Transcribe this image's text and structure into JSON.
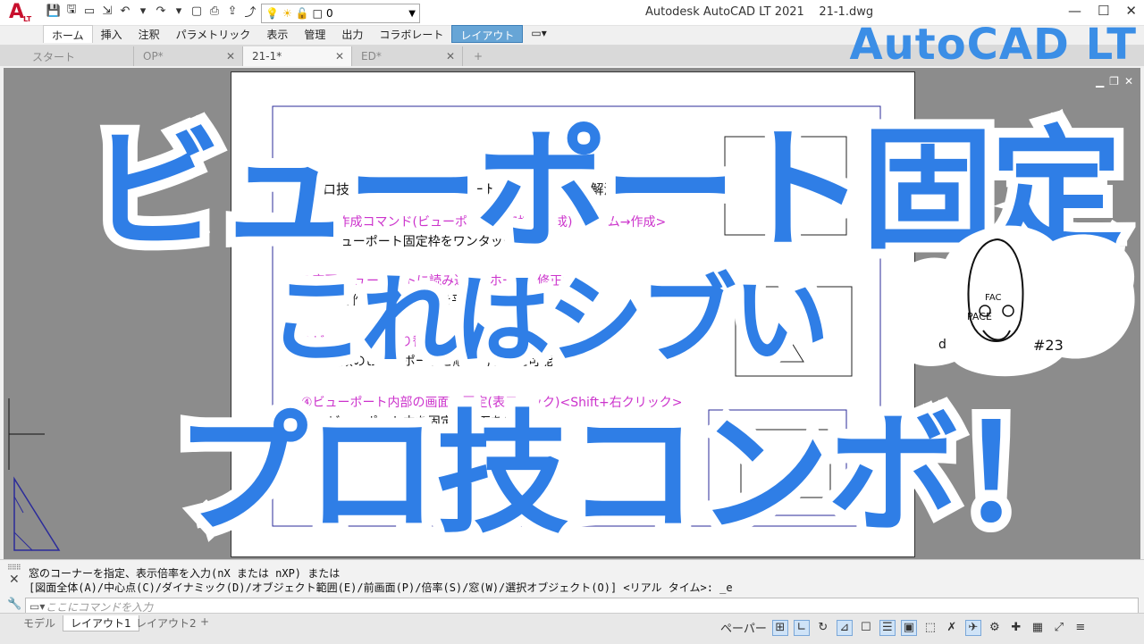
{
  "app": {
    "title": "Autodesk AutoCAD LT 2021",
    "file": "21-1.dwg",
    "logo_letter": "A",
    "logo_sub": "LT"
  },
  "layer_value": "0",
  "ribbon_tabs": [
    "ホーム",
    "挿入",
    "注釈",
    "パラメトリック",
    "表示",
    "管理",
    "出力",
    "コラボレート",
    "レイアウト"
  ],
  "doc_tabs": [
    "スタート",
    "OP*",
    "21-1*",
    "ED*"
  ],
  "brand": "AutoCAD LT",
  "paper_text": {
    "heading": "【プロ技コンボ！】ビューポートの固定はこれで解消！",
    "line1": "①境界作成コマンド(ビューポート固定枠の作成)<ホーム→作成>",
    "line2": "→ビューポート固定枠をワンタッチ作成",
    "line3": "②変更 ビューポートに読み込み<ホーム→修正>",
    "line4": "→①で作成した固定枠を平行移動(画面はdrafts)に",
    "line5": "③ビューポート切り替え<CTRL+R>",
    "line6": "→複数のビューポートを順次切り替え可能",
    "line7": "④ビューポート内部の画面の固定(表示ロック)<Shift+右クリック>",
    "line8": "→ビューポート内を固定、画面をズーム"
  },
  "overlay": {
    "line1": "ビューポート固定",
    "line2": "これはシブい",
    "line3": "プロ技コンボ！"
  },
  "mascot": {
    "badge": "#23",
    "letters": "PACE",
    "extra": "d",
    "top": "FAC"
  },
  "command": {
    "line1": "窓のコーナーを指定、表示倍率を入力(nX または nXP) または",
    "line2": "[図面全体(A)/中心点(C)/ダイナミック(D)/オブジェクト範囲(E)/前画面(P)/倍率(S)/窓(W)/選択オブジェクト(O)] <リアル タイム>: _e",
    "placeholder": "ここにコマンドを入力"
  },
  "layout_tabs": [
    "モデル",
    "レイアウト1",
    "レイアウト2"
  ],
  "status_label": "ペーパー",
  "colors": {
    "accent": "#2f7ee6",
    "magenta": "#cc33cc",
    "paper_frame": "#2b2b9a"
  }
}
